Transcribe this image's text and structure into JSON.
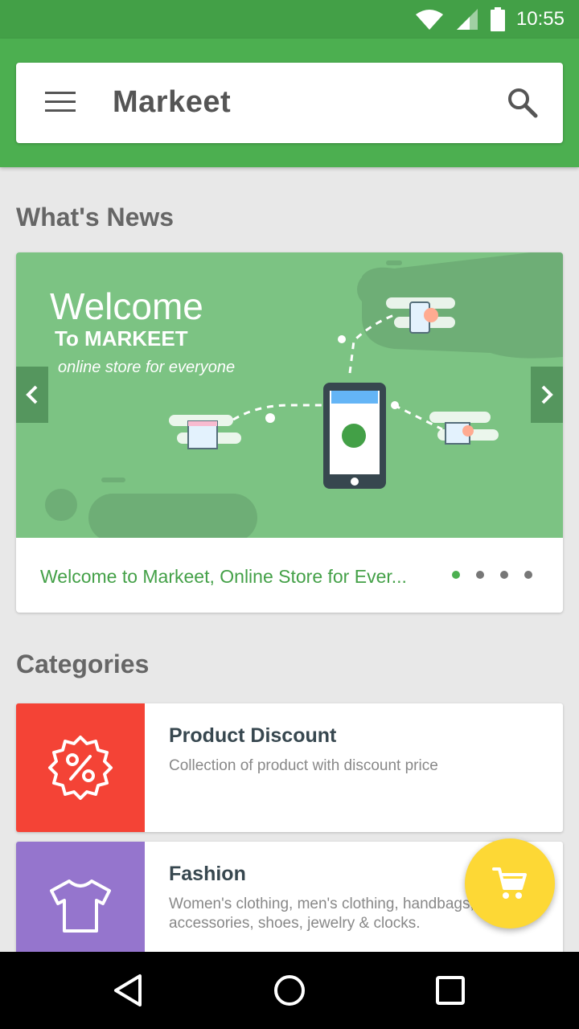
{
  "status_bar": {
    "time": "10:55"
  },
  "app_bar": {
    "title": "Markeet"
  },
  "news": {
    "heading": "What's News",
    "banner": {
      "welcome": "Welcome",
      "to_brand": "To MARKEET",
      "tagline": "online store for everyone",
      "caption": "Welcome to Markeet, Online Store for Ever...",
      "slide_count": 4,
      "active_slide": 1
    }
  },
  "categories": {
    "heading": "Categories",
    "items": [
      {
        "title": "Product Discount",
        "description": "Collection of product with discount price",
        "color": "#f44336",
        "icon": "discount-badge-icon"
      },
      {
        "title": "Fashion",
        "description": "Women's clothing, men's clothing, handbags, accessories, shoes, jewelry & clocks.",
        "color": "#9575cd",
        "icon": "tshirt-icon"
      }
    ]
  },
  "fab": {
    "icon": "cart-icon",
    "color": "#fdd835"
  },
  "colors": {
    "primary": "#4caf50",
    "primary_dark": "#43a047"
  }
}
